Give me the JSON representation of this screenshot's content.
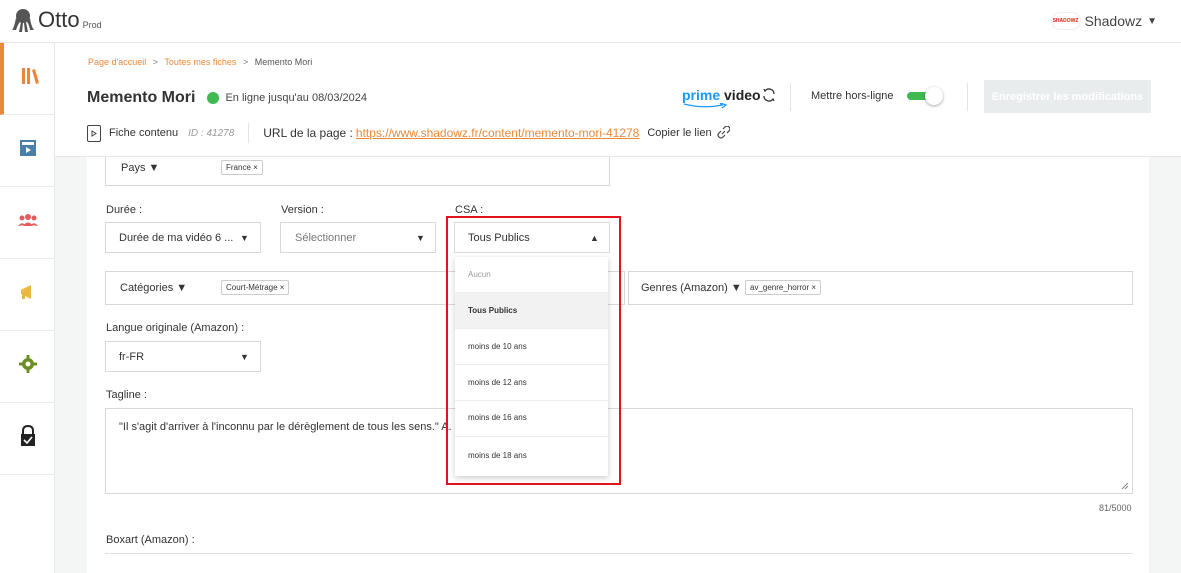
{
  "app": {
    "name": "Otto",
    "env": "Prod"
  },
  "user": {
    "name": "Shadowz",
    "badge": "SHADOWZ"
  },
  "sidebar": {
    "items": [
      {
        "icon": "library-icon",
        "active": true
      },
      {
        "icon": "catalog-icon"
      },
      {
        "icon": "users-icon"
      },
      {
        "icon": "megaphone-icon"
      },
      {
        "icon": "gear-icon"
      },
      {
        "icon": "lock-icon"
      }
    ]
  },
  "breadcrumb": {
    "home": "Page d'accueil",
    "list": "Toutes mes fiches",
    "current": "Memento Mori",
    "sep": ">"
  },
  "header": {
    "title": "Memento Mori",
    "status": "En ligne jusqu'au 08/03/2024",
    "prime_prefix": "prime",
    "prime_suffix": "video",
    "offline_label": "Mettre hors-ligne",
    "save_label": "Enregistrer les modifications",
    "sheet_label": "Fiche contenu",
    "sheet_id": "ID : 41278",
    "url_label": "URL de la page :",
    "url": "https://www.shadowz.fr/content/memento-mori-41278",
    "copy_label": "Copier le lien"
  },
  "form": {
    "pays": {
      "label": "Pays ▼",
      "chip": "France ×"
    },
    "duree": {
      "label": "Durée :",
      "value": "Durée de ma vidéo 6 ..."
    },
    "version": {
      "label": "Version :",
      "placeholder": "Sélectionner"
    },
    "csa": {
      "label": "CSA :",
      "value": "Tous Publics"
    },
    "categories": {
      "label": "Catégories ▼",
      "chip": "Court-Métrage ×"
    },
    "genres": {
      "label": "Genres (Amazon) ▼",
      "chip": "av_genre_horror ×"
    },
    "langue": {
      "label": "Langue originale (Amazon) :",
      "value": "fr-FR"
    },
    "tagline": {
      "label": "Tagline :",
      "value": "\"Il s'agit d'arriver à l'inconnu par le dérèglement de tous les sens.\" A. Ri",
      "counter": "81/5000"
    },
    "boxart": {
      "label": "Boxart (Amazon) :"
    }
  },
  "csa_menu": {
    "options": [
      "Aucun",
      "Tous Publics",
      "moins de 10 ans",
      "moins de 12 ans",
      "moins de 16 ans",
      "moins de 18 ans"
    ],
    "selected": "Tous Publics"
  },
  "colors": {
    "accent": "#e8893a",
    "online": "#3fb950",
    "prime": "#1a98ff",
    "highlight": "#e1131c"
  }
}
